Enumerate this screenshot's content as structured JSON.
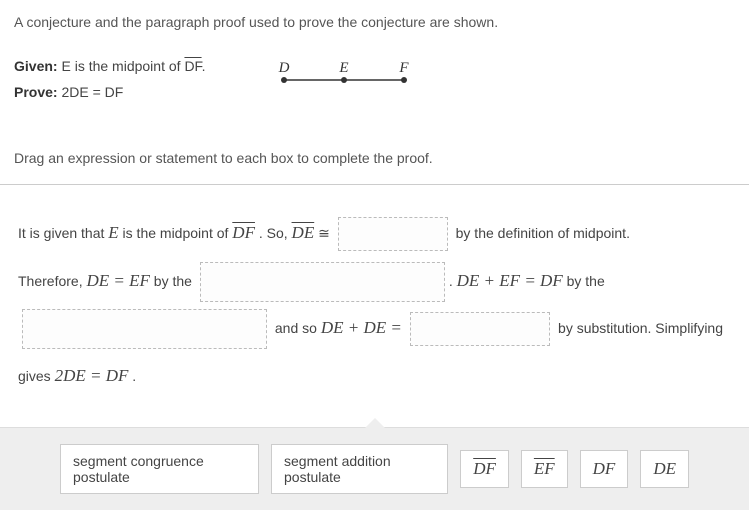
{
  "intro": "A conjecture and the paragraph proof used to prove the conjecture are shown.",
  "given": {
    "label": "Given:",
    "prefix": "E",
    "mid": " is the midpoint of ",
    "seg": "DF",
    "suffix": "."
  },
  "prove": {
    "label": "Prove:",
    "eq1": "2DE",
    "eqsign": " = ",
    "eq2": "DF"
  },
  "diagram": {
    "labels": [
      "D",
      "E",
      "F"
    ]
  },
  "instructions": "Drag an expression or statement to each box to complete the proof.",
  "proof": {
    "t1a": "It is given that ",
    "t1b": "E",
    "t1c": " is the midpoint of ",
    "t1d": "DF",
    "t1e": " . So, ",
    "t1f": "DE",
    "t1g": " ≅ ",
    "t1h": " by the definition of midpoint.",
    "t2a": "Therefore, ",
    "t2eq1l": "DE",
    "t2eq1m": " = ",
    "t2eq1r": "EF",
    "t2b": " by the ",
    "t2c": ". ",
    "t2eq2l": "DE",
    "t2eq2plus": " + ",
    "t2eq2m": "EF",
    "t2eq2eq": " = ",
    "t2eq2r": "DF",
    "t2d": " by the",
    "t3a": " and so ",
    "t3eq1l": "DE",
    "t3eq1plus": " + ",
    "t3eq1m": "DE",
    "t3eq1eq": " = ",
    "t3b": " by substitution. Simplifying",
    "t4a": "gives ",
    "t4eq1l": "2DE",
    "t4eq1m": " = ",
    "t4eq1r": "DF",
    "t4b": " ."
  },
  "tokens": {
    "scp": "segment congruence postulate",
    "sap": "segment addition postulate",
    "df_ov": "DF",
    "ef_ov": "EF",
    "df": "DF",
    "de": "DE"
  }
}
